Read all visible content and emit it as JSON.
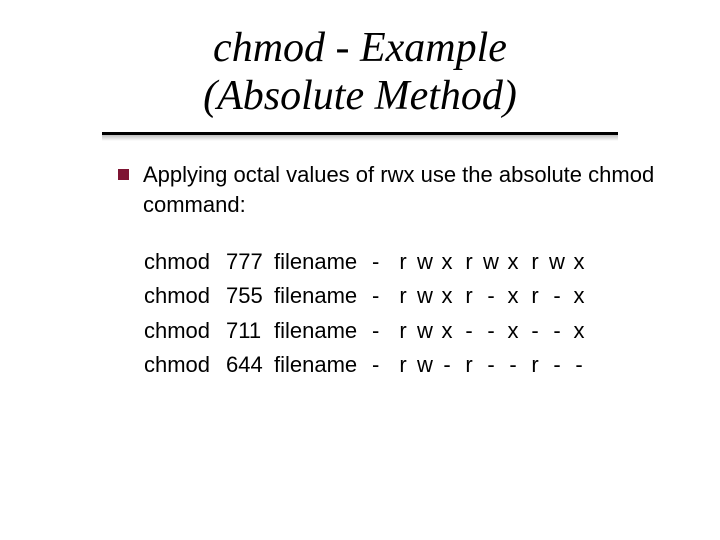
{
  "title_line1": "chmod - Example",
  "title_line2": "(Absolute Method)",
  "lead": "Applying octal values of rwx use the absolute chmod command:",
  "examples": [
    {
      "cmd": "chmod",
      "mode": "777",
      "file": "filename",
      "dash": "-",
      "perms": [
        "r",
        "w",
        "x",
        "r",
        "w",
        "x",
        "r",
        "w",
        "x"
      ]
    },
    {
      "cmd": "chmod",
      "mode": "755",
      "file": "filename",
      "dash": "-",
      "perms": [
        "r",
        "w",
        "x",
        "r",
        "-",
        "x",
        "r",
        "-",
        "x"
      ]
    },
    {
      "cmd": "chmod",
      "mode": "711",
      "file": "filename",
      "dash": "-",
      "perms": [
        "r",
        "w",
        "x",
        "-",
        "-",
        "x",
        "-",
        "-",
        "x"
      ]
    },
    {
      "cmd": "chmod",
      "mode": "644",
      "file": "filename",
      "dash": "-",
      "perms": [
        "r",
        "w",
        "-",
        "r",
        "-",
        "-",
        "r",
        "-",
        "-"
      ]
    }
  ]
}
